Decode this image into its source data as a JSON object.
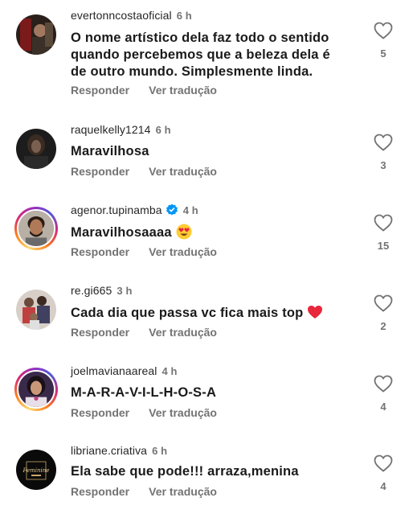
{
  "comments": [
    {
      "username": "evertonncostaoficial",
      "time": "6 h",
      "text": "O nome artístico dela faz todo o sentido quando percebemos que a beleza dela é de outro mundo. Simplesmente linda.",
      "reply_label": "Responder",
      "translate_label": "Ver tradução",
      "likes": "5",
      "avatar": "profile-photo-dark",
      "story_ring": false,
      "verified": false
    },
    {
      "username": "raquelkelly1214",
      "time": "6 h",
      "text": "Maravilhosa",
      "reply_label": "Responder",
      "translate_label": "Ver tradução",
      "likes": "3",
      "avatar": "profile-photo-dark-portrait",
      "story_ring": false,
      "verified": false
    },
    {
      "username": "agenor.tupinamba",
      "time": "4 h",
      "text": "Maravilhosaaaa",
      "text_emoji": "heart-eyes-emoji",
      "reply_label": "Responder",
      "translate_label": "Ver tradução",
      "likes": "15",
      "avatar": "profile-photo-man",
      "story_ring": true,
      "verified": true
    },
    {
      "username": "re.gi665",
      "time": "3 h",
      "text": "Cada dia que passa vc fica mais top",
      "text_emoji": "red-heart-emoji",
      "reply_label": "Responder",
      "translate_label": "Ver tradução",
      "likes": "2",
      "avatar": "profile-photo-family",
      "story_ring": false,
      "verified": false
    },
    {
      "username": "joelmavianaareal",
      "time": "4 h",
      "text": "M-A-R-A-V-I-L-H-O-S-A",
      "reply_label": "Responder",
      "translate_label": "Ver tradução",
      "likes": "4",
      "avatar": "profile-photo-woman",
      "story_ring": true,
      "verified": false
    },
    {
      "username": "libriane.criativa",
      "time": "6 h",
      "text": "Ela sabe que pode!!! arraza,menina",
      "reply_label": "Responder",
      "translate_label": "Ver tradução",
      "likes": "4",
      "avatar": "logo-feminine-black",
      "avatar_logo_text": "Feminine",
      "story_ring": false,
      "verified": false
    }
  ],
  "colors": {
    "text": "#1a1a1a",
    "secondary": "#737373",
    "verified": "#0095f6",
    "heart": "#ed4956"
  }
}
